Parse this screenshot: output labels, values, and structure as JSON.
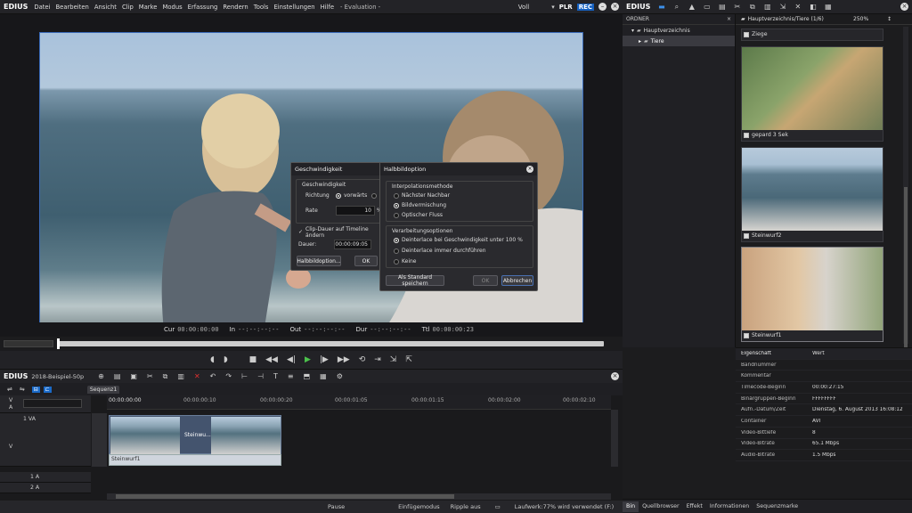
{
  "menubar": {
    "logo": "EDIUS",
    "items": [
      "Datei",
      "Bearbeiten",
      "Ansicht",
      "Clip",
      "Marke",
      "Modus",
      "Erfassung",
      "Rendern",
      "Tools",
      "Einstellungen",
      "Hilfe"
    ],
    "title": "- Evaluation -",
    "view_mode": "Voll",
    "plr": "PLR",
    "rec": "REC"
  },
  "preview": {
    "tc": [
      {
        "k": "Cur",
        "v": "00:00:00:00"
      },
      {
        "k": "In",
        "v": "--:--:--:--"
      },
      {
        "k": "Out",
        "v": "--:--:--:--"
      },
      {
        "k": "Dur",
        "v": "--:--:--:--"
      },
      {
        "k": "Ttl",
        "v": "00:00:00:23"
      }
    ]
  },
  "speed_dialog": {
    "title": "Geschwindigkeit",
    "group": "Geschwindigkeit",
    "direction_label": "Richtung",
    "direction_fwd": "vorwärts",
    "direction_rev": "r",
    "rate_label": "Rate",
    "rate_value": "10",
    "rate_unit": "%",
    "checkbox_label": "Clip-Dauer auf Timeline ändern",
    "duration_label": "Dauer:",
    "duration_value": "00:00:09:05",
    "field_button": "Halbbildoption...",
    "ok": "OK"
  },
  "field_dialog": {
    "title": "Halbbildoption",
    "interp_title": "Interpolationsmethode",
    "interp_options": [
      "Nächster Nachbar",
      "Bildvermischung",
      "Optischer Fluss"
    ],
    "interp_selected": 1,
    "proc_title": "Verarbeitungsoptionen",
    "proc_options": [
      "Deinterlace bei Geschwindigkeit unter 100 %",
      "Deinterlace immer durchführen",
      "Keine"
    ],
    "proc_selected": 0,
    "default_button": "Als Standard speichern",
    "ok": "OK",
    "cancel": "Abbrechen"
  },
  "timeline": {
    "logo": "EDIUS",
    "project": "2018-Beispiel-50p",
    "sequence_tab": "Sequenz1",
    "ruler_labels": [
      "00:00:00:00",
      "00:00:00:10",
      "00:00:00:20",
      "00:00:01:05",
      "00:00:01:15",
      "00:00:02:00",
      "00:00:02:10"
    ],
    "track_v": "V",
    "track_a": "A",
    "track_va": "1 VA",
    "track_a1": "1 A",
    "track_a2": "2 A",
    "clip_label": "Steinwu...",
    "clip_audio_label": "Steinwurf1"
  },
  "status": {
    "pause": "Pause",
    "insert_mode": "Einfügemodus",
    "ripple": "Ripple aus",
    "drive": "Laufwerk:77% wird verwendet (F:)"
  },
  "right": {
    "logo": "EDIUS",
    "folder_header": "ORDNER",
    "root": "Hauptverzeichnis",
    "child": "Tiere",
    "path": "Hauptverzeichnis/Tiere (1/6)",
    "zoom": "250%",
    "thumbs": [
      "Ziege",
      "gepard 3 Sek",
      "Steinwurf2",
      "Steinwurf1"
    ]
  },
  "props": {
    "head_k": "Eigenschaft",
    "head_v": "Wert",
    "rows": [
      {
        "k": "Bandnummer",
        "v": ""
      },
      {
        "k": "Kommentar",
        "v": ""
      },
      {
        "k": "Timecode-Beginn",
        "v": "00:00:27:15"
      },
      {
        "k": "Binärgruppen-Beginn",
        "v": "FFFFFFFF"
      },
      {
        "k": "Aufn.-Datum/Zeit",
        "v": "Dienstag, 6. August 2013 16:08:12"
      },
      {
        "k": "Container",
        "v": "AVI"
      },
      {
        "k": "Video-Bittiefe",
        "v": "8"
      },
      {
        "k": "Video-Bitrate",
        "v": "65.1 Mbps"
      },
      {
        "k": "Audio-Bitrate",
        "v": "1.5 Mbps"
      }
    ]
  },
  "rtabs": [
    "Bin",
    "Quellbrowser",
    "Effekt",
    "Informationen",
    "Sequenzmarke"
  ]
}
